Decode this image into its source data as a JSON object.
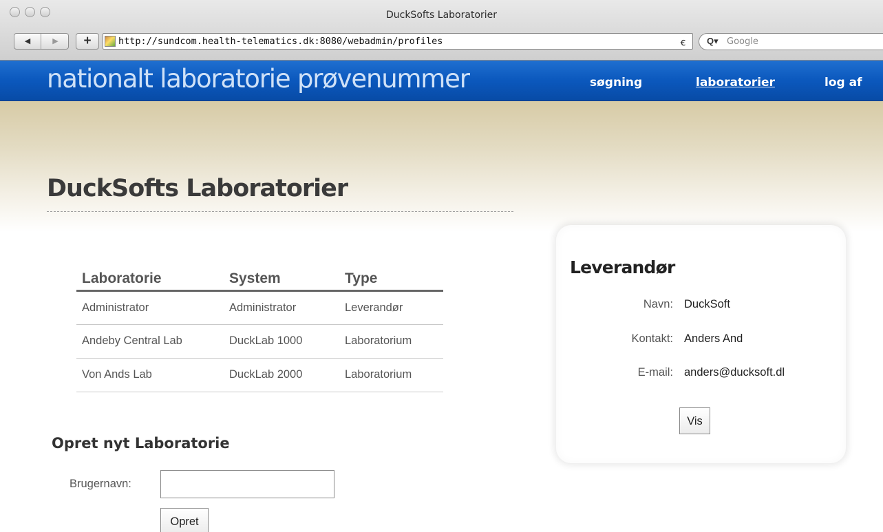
{
  "browser": {
    "window_title": "DuckSofts Laboratorier",
    "back_icon": "◀",
    "forward_icon": "▶",
    "add_icon": "+",
    "url": "http://sundcom.health-telematics.dk:8080/webadmin/profiles",
    "reload_icon": "ꞓ",
    "search_icon": "Q▾",
    "search_placeholder": "Google"
  },
  "site": {
    "logo": "nationalt laboratorie prøvenummer",
    "nav": {
      "search": "søgning",
      "labs": "laboratorier",
      "logout": "log af"
    },
    "header_color": "#0b58bd"
  },
  "page": {
    "title": "DuckSofts Laboratorier"
  },
  "table": {
    "headers": [
      "Laboratorie",
      "System",
      "Type"
    ],
    "rows": [
      [
        "Administrator",
        "Administrator",
        "Leverandør"
      ],
      [
        "Andeby Central Lab",
        "DuckLab 1000",
        "Laboratorium"
      ],
      [
        "Von Ands Lab",
        "DuckLab 2000",
        "Laboratorium"
      ]
    ]
  },
  "create_form": {
    "heading": "Opret nyt Laboratorie",
    "username_label": "Brugernavn:",
    "username_value": "",
    "submit_label": "Opret"
  },
  "supplier": {
    "heading": "Leverandør",
    "name_label": "Navn:",
    "name_value": "DuckSoft",
    "contact_label": "Kontakt:",
    "contact_value": "Anders And",
    "email_label": "E-mail:",
    "email_value": "anders@ducksoft.dl",
    "show_label": "Vis"
  }
}
